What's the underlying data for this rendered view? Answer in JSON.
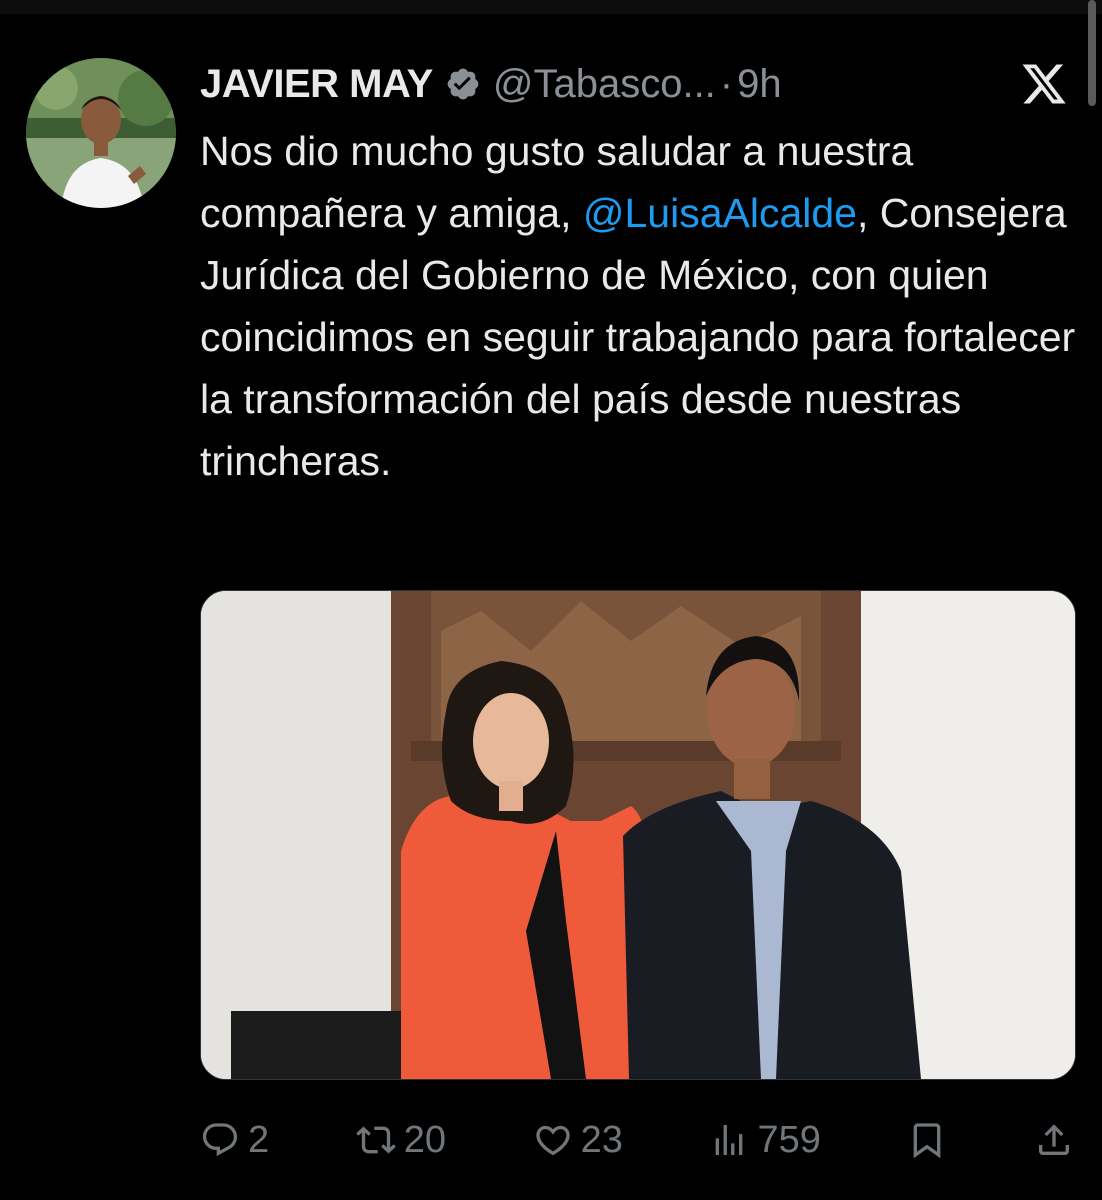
{
  "tweet": {
    "author": {
      "display_name": "JAVIER MAY",
      "handle": "@Tabasco...",
      "verified": true,
      "avatar": "avatar-photo"
    },
    "separator": "·",
    "time": "9h",
    "text_before_mention": "Nos dio mucho gusto saludar a nuestra compañera y amiga, ",
    "mention": "@LuisaAlcalde",
    "text_after_mention": ", Consejera Jurídica del Gobierno de México, con quien coincidimos en seguir trabajando para fortalecer la transformación del país desde nuestras trincheras.",
    "media": "photo-two-people",
    "metrics": {
      "replies": "2",
      "retweets": "20",
      "likes": "23",
      "views": "759"
    }
  },
  "icons": {
    "verified": "verified-badge-icon",
    "logo": "x-logo-icon",
    "reply": "reply-icon",
    "retweet": "retweet-icon",
    "like": "heart-icon",
    "views": "views-icon",
    "bookmark": "bookmark-icon",
    "share": "share-icon"
  },
  "colors": {
    "background": "#000000",
    "text": "#e7e9ea",
    "secondary": "#71767b",
    "link": "#1d9bf0"
  }
}
